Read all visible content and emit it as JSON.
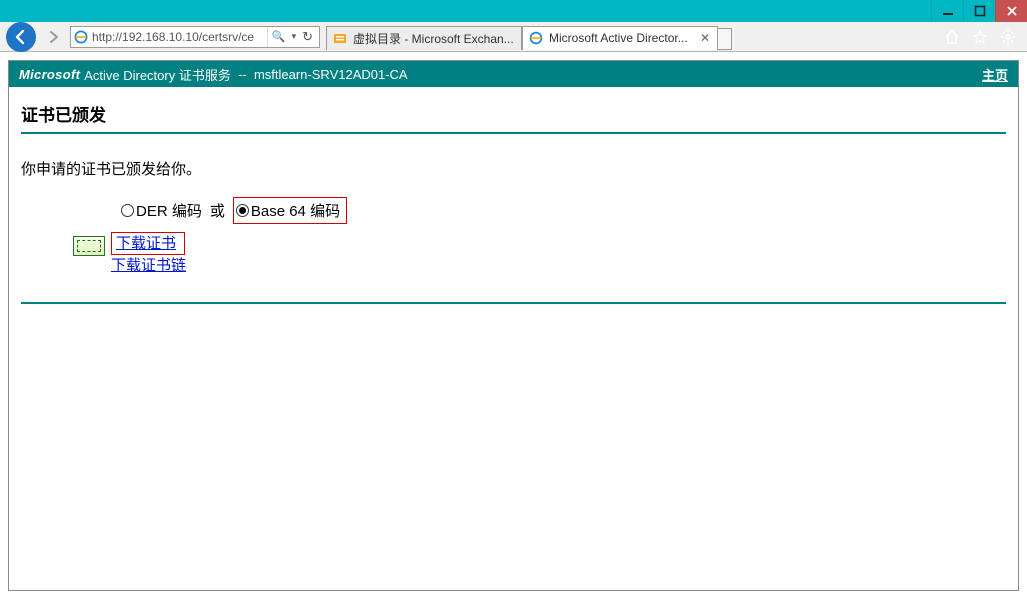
{
  "window": {
    "controls": {
      "min": "minimize",
      "max": "maximize",
      "close": "close"
    }
  },
  "chrome": {
    "url": "http://192.168.10.10/certsrv/ce",
    "search_glyph": "🔍",
    "refresh_glyph": "↻",
    "tabs": [
      {
        "title": "虚拟目录 - Microsoft Exchan...",
        "active": false
      },
      {
        "title": "Microsoft Active Director...",
        "active": true
      }
    ],
    "right_icons": [
      "home",
      "star",
      "gear"
    ]
  },
  "banner": {
    "brand": "Microsoft",
    "product": " Active Directory 证书服务",
    "sep": "  --  ",
    "ca": "msftlearn-SRV12AD01-CA",
    "home_label": "主页"
  },
  "page": {
    "heading": "证书已颁发",
    "note": "你申请的证书已颁发给你。",
    "enc": {
      "der_label": "DER 编码",
      "or": "或",
      "b64_label": "Base 64 编码"
    },
    "download": {
      "cert": "下载证书",
      "chain": "下载证书链"
    }
  }
}
